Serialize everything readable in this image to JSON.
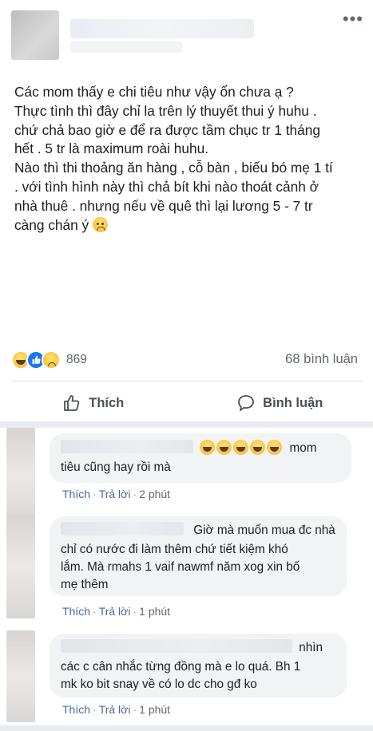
{
  "post": {
    "lines": [
      "Các mom thấy e chi tiêu như vậy ổn chưa ạ ?",
      "Thực tình thì đây chỉ la trên lý thuyết thui ý huhu .",
      "chứ chả bao giờ e để ra được tầm chục tr 1 tháng",
      "hết . 5 tr là maximum roài huhu.",
      "Nào thì thi thoảng ăn hàng , cỗ bàn , biếu bó mẹ 1 tí",
      ". với tình hình này thì chả bít khi nào thoát cảnh ở",
      "nhà thuê . nhưng nếu về quê thì lại lương 5 - 7 tr",
      "càng chán ý"
    ],
    "reaction_count": "869",
    "comment_count": "68 bình luận",
    "reaction_icons": [
      "haha-icon",
      "like-icon",
      "sad-icon"
    ]
  },
  "actions": {
    "like_label": "Thích",
    "comment_label": "Bình luận"
  },
  "comments": [
    {
      "text_after_name": "mom",
      "text_line2": "tiêu cũng hay rồi mà",
      "emojis": 5,
      "like": "Thích",
      "reply": "Trả lời",
      "time": "2 phút"
    },
    {
      "line1": "Giờ mà muốn mua đc nhà",
      "line2": "chỉ có nước đi làm thêm chứ tiết kiệm khó",
      "line3": "lắm. Mà rmahs 1 vaif nawmf năm xog xin bố",
      "line4": "mẹ thêm",
      "like": "Thích",
      "reply": "Trả lời",
      "time": "1 phút"
    },
    {
      "line1": "nhìn",
      "line2": "các c cân nhắc từng đồng mà e lo quá. Bh 1",
      "line3": "mk ko bit snay về có lo dc cho gđ ko",
      "like": "Thích",
      "reply": "Trả lời",
      "time": "1 phút"
    }
  ],
  "colors": {
    "link": "#4b67a1",
    "bubble": "#f2f3f5",
    "separator": "#e9ebee",
    "like_blue": "#1877f2"
  }
}
